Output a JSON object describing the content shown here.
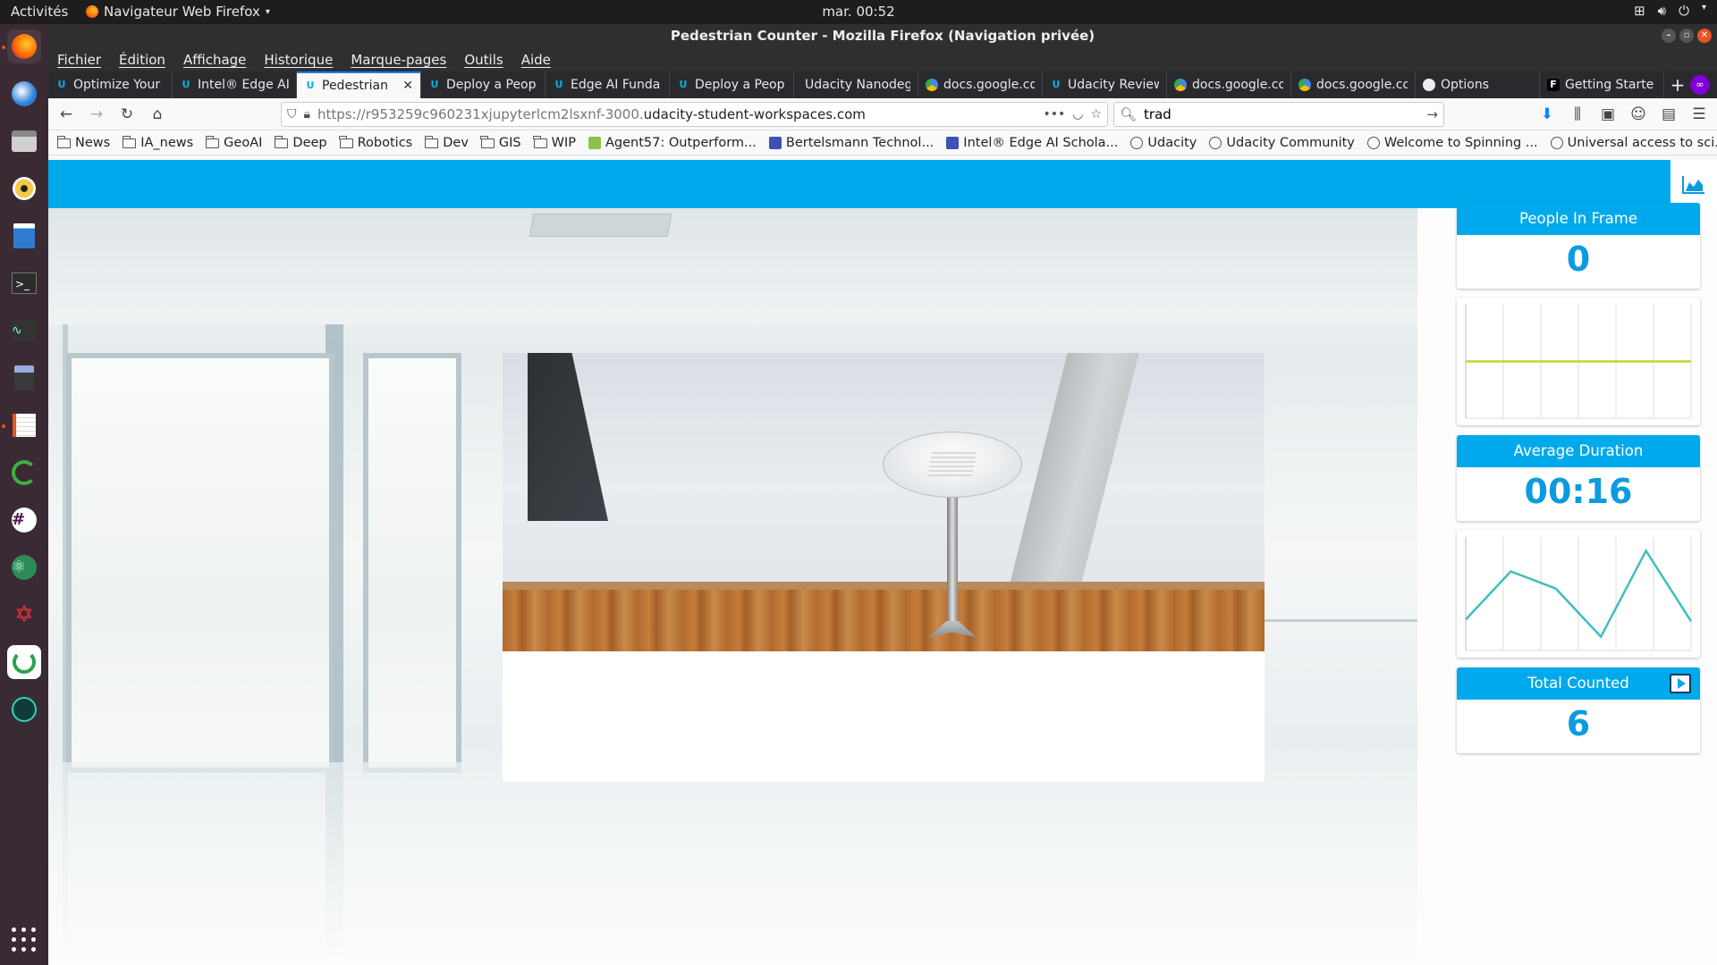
{
  "topbar": {
    "activities": "Activités",
    "app_menu": "Navigateur Web Firefox",
    "clock": "mar. 00:52"
  },
  "window": {
    "title": "Pedestrian Counter - Mozilla Firefox (Navigation privée)"
  },
  "menu": [
    "Fichier",
    "Édition",
    "Affichage",
    "Historique",
    "Marque-pages",
    "Outils",
    "Aide"
  ],
  "tabs": [
    {
      "label": "Optimize Your",
      "icon": "udacity-icon",
      "active": false
    },
    {
      "label": "Intel® Edge AI",
      "icon": "udacity-icon",
      "active": false
    },
    {
      "label": "Pedestrian",
      "icon": "udacity-icon",
      "active": true
    },
    {
      "label": "Deploy a Peop",
      "icon": "udacity-icon",
      "active": false
    },
    {
      "label": "Edge AI Funda",
      "icon": "udacity-icon",
      "active": false
    },
    {
      "label": "Deploy a Peop",
      "icon": "udacity-icon",
      "active": false
    },
    {
      "label": "Udacity Nanodeg",
      "icon": "none",
      "active": false
    },
    {
      "label": "docs.google.co",
      "icon": "google-drive-icon",
      "active": false
    },
    {
      "label": "Udacity Review",
      "icon": "udacity-icon",
      "active": false
    },
    {
      "label": "docs.google.co",
      "icon": "google-drive-icon",
      "active": false
    },
    {
      "label": "docs.google.co",
      "icon": "google-drive-icon",
      "active": false
    },
    {
      "label": "Options",
      "icon": "github-icon",
      "active": false
    },
    {
      "label": "Getting Starte",
      "icon": "f-icon",
      "active": false
    }
  ],
  "navbar": {
    "url_prefix": "https://r953259c960231xjupyterlcm2lsxnf-3000.",
    "url_domain": "udacity-student-workspaces.com",
    "search_value": "trad"
  },
  "bookmarks": [
    {
      "label": "News",
      "type": "folder"
    },
    {
      "label": "IA_news",
      "type": "folder"
    },
    {
      "label": "GeoAI",
      "type": "folder"
    },
    {
      "label": "Deep",
      "type": "folder"
    },
    {
      "label": "Robotics",
      "type": "folder"
    },
    {
      "label": "Dev",
      "type": "folder"
    },
    {
      "label": "GIS",
      "type": "folder"
    },
    {
      "label": "WIP",
      "type": "folder"
    },
    {
      "label": "Agent57: Outperform...",
      "type": "link",
      "color": "#8bc34a"
    },
    {
      "label": "Bertelsmann Technol...",
      "type": "link",
      "color": "#3f51b5"
    },
    {
      "label": "Intel® Edge AI Schola...",
      "type": "link",
      "color": "#3f51b5"
    },
    {
      "label": "Udacity",
      "type": "globe"
    },
    {
      "label": "Udacity Community",
      "type": "globe"
    },
    {
      "label": "Welcome to Spinning ...",
      "type": "globe"
    },
    {
      "label": "Universal access to sci...",
      "type": "globe"
    }
  ],
  "stats": {
    "people_in_frame": {
      "label": "People In Frame",
      "value": "0"
    },
    "average_duration": {
      "label": "Average Duration",
      "value": "00:16"
    },
    "total_counted": {
      "label": "Total Counted",
      "value": "6"
    }
  },
  "colors": {
    "accent": "#00a9ec",
    "line_people": "#c3d62c",
    "line_duration": "#3fbfbf"
  },
  "chart_data": [
    {
      "type": "line",
      "series": [
        {
          "values": [
            0,
            0,
            0,
            0,
            0,
            0,
            0
          ]
        }
      ],
      "ylim": [
        -1,
        1
      ],
      "grid": true
    },
    {
      "type": "line",
      "series": [
        {
          "values": [
            10,
            38,
            28,
            0,
            50,
            9
          ]
        }
      ],
      "ylim": [
        -8,
        58
      ],
      "grid": true
    }
  ]
}
